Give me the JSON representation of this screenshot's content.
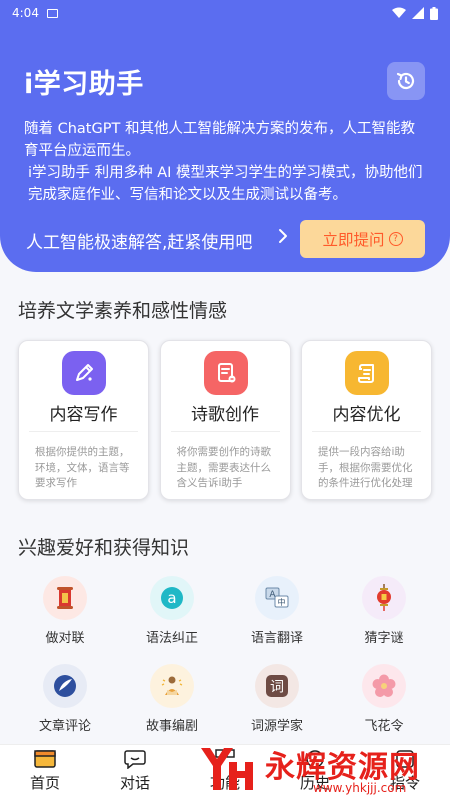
{
  "status_bar": {
    "time": "4:04"
  },
  "hero": {
    "title": "i学习助手",
    "desc1": "随着 ChatGPT 和其他人工智能解决方案的发布，人工智能教育平台应运而生。",
    "desc2": "i学习助手 利用多种 AI 模型来学习学生的学习模式，协助他们完成家庭作业、写信和论文以及生成测试以备考。",
    "cta_text": "人工智能极速解答,赶紧使用吧",
    "ask_button": "立即提问"
  },
  "section1": {
    "title": "培养文学素养和感性情感",
    "cards": [
      {
        "title": "内容写作",
        "desc": "根据你提供的主题，环境，文体，语言等要求写作",
        "icon": "pencil-icon",
        "color": "#7b61f0"
      },
      {
        "title": "诗歌创作",
        "desc": "将你需要创作的诗歌主题，需要表达什么含义告诉i助手",
        "icon": "document-icon",
        "color": "#f56565"
      },
      {
        "title": "内容优化",
        "desc": "提供一段内容给i助手，根据你需要优化的条件进行优化处理",
        "icon": "scroll-icon",
        "color": "#f7b731"
      }
    ]
  },
  "section2": {
    "title": "兴趣爱好和获得知识",
    "items": [
      {
        "label": "做对联",
        "icon": "couplet-icon",
        "bg": "#fde8e4"
      },
      {
        "label": "语法纠正",
        "icon": "grammar-a-icon",
        "bg": "#e1f6f8"
      },
      {
        "label": "语言翻译",
        "icon": "translate-icon",
        "bg": "#e8f1fb"
      },
      {
        "label": "猜字谜",
        "icon": "lantern-icon",
        "bg": "#f5ebf9"
      },
      {
        "label": "文章评论",
        "icon": "comment-icon",
        "bg": "#e7ebf5"
      },
      {
        "label": "故事编剧",
        "icon": "storyteller-icon",
        "bg": "#fdf2de"
      },
      {
        "label": "词源学家",
        "icon": "etymology-icon",
        "bg": "#f3e7e4"
      },
      {
        "label": "飞花令",
        "icon": "flower-icon",
        "bg": "#fde7ec"
      }
    ]
  },
  "tabbar": {
    "tabs": [
      {
        "label": "首页",
        "icon": "home-icon"
      },
      {
        "label": "对话",
        "icon": "chat-icon"
      },
      {
        "label": "功能",
        "icon": "apps-icon"
      },
      {
        "label": "历史",
        "icon": "history-icon"
      },
      {
        "label": "指令",
        "icon": "command-icon"
      }
    ]
  },
  "watermark": {
    "text": "永辉资源网",
    "url": "www.yhkjjj.com"
  }
}
